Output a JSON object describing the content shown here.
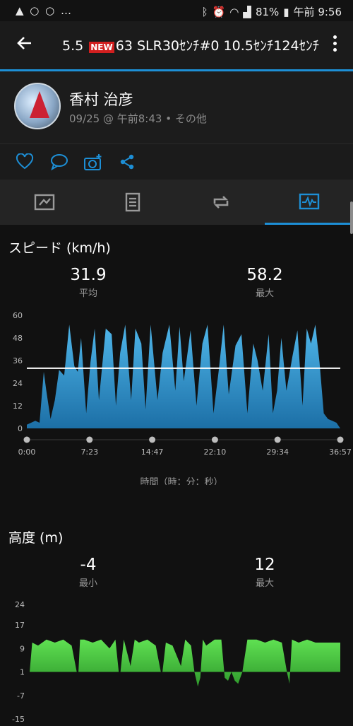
{
  "status_bar": {
    "left_text": "▲ ○ ○ …",
    "battery": "81%",
    "time": "午前 9:56",
    "icons": [
      "image-icon",
      "sync-icon",
      "sync-icon",
      "more-icon",
      "bluetooth-icon",
      "alarm-icon",
      "volte-icon",
      "wifi-icon",
      "signal-icon",
      "battery-icon"
    ]
  },
  "app_bar": {
    "title_prefix": "5.5",
    "badge": "NEW",
    "title_suffix": "63  SLR30ｾﾝﾁ#0  10.5ｾﾝﾁ124ｾﾝﾁ"
  },
  "profile": {
    "name": "香村 治彦",
    "meta": "09/25 @ 午前8:43 • その他"
  },
  "actions": [
    "heart-icon",
    "comment-icon",
    "camera-add-icon",
    "share-icon"
  ],
  "tabs": [
    {
      "name": "tab-map",
      "icon": "map-icon"
    },
    {
      "name": "tab-details",
      "icon": "details-icon"
    },
    {
      "name": "tab-laps",
      "icon": "laps-icon"
    },
    {
      "name": "tab-charts",
      "icon": "chart-icon",
      "active": true
    }
  ],
  "colors": {
    "accent": "#1d8fd6",
    "speed_fill": "#2f9fd9",
    "elevation_fill": "#4fcf46"
  },
  "speed": {
    "title": "スピード (km/h)",
    "avg_value": "31.9",
    "avg_label": "平均",
    "max_value": "58.2",
    "max_label": "最大",
    "x_axis_title": "時間（時：分：秒）"
  },
  "elevation": {
    "title": "高度 (m)",
    "min_value": "-4",
    "min_label": "最小",
    "max_value": "12",
    "max_label": "最大"
  },
  "chart_data": [
    {
      "type": "area",
      "y_unit": "km/h",
      "ylim": [
        0,
        60
      ],
      "yticks": [
        "0",
        "12",
        "24",
        "36",
        "48",
        "60"
      ],
      "xticks": [
        "0:00",
        "7:23",
        "14:47",
        "22:10",
        "29:34",
        "36:57"
      ],
      "x_minutes": [
        0,
        0.5,
        1,
        1.5,
        2,
        2.3,
        2.8,
        3.3,
        3.8,
        4.4,
        5,
        5.6,
        6,
        6.4,
        7,
        7.5,
        8,
        8.5,
        9.3,
        10,
        10.5,
        11,
        11.6,
        12.3,
        12.8,
        13.5,
        14,
        14.6,
        15.4,
        16,
        16.8,
        17.5,
        18,
        18.5,
        19.3,
        20,
        20.7,
        21.3,
        22,
        22.6,
        23.2,
        23.8,
        24.6,
        25.3,
        26,
        26.7,
        27.2,
        27.8,
        28.5,
        29,
        29.5,
        30,
        30.6,
        31.3,
        31.9,
        32.5,
        33,
        33.5,
        34,
        34.5,
        35,
        35.5,
        36,
        36.5,
        36.95
      ],
      "values": [
        2,
        3,
        4,
        3,
        30,
        20,
        5,
        15,
        31,
        28,
        55,
        33,
        30,
        48,
        8,
        35,
        53,
        15,
        53,
        50,
        12,
        40,
        55,
        15,
        53,
        45,
        10,
        55,
        15,
        40,
        55,
        20,
        54,
        25,
        52,
        12,
        45,
        55,
        8,
        30,
        55,
        18,
        44,
        50,
        8,
        45,
        36,
        20,
        50,
        8,
        20,
        48,
        20,
        38,
        52,
        12,
        53,
        45,
        55,
        35,
        8,
        5,
        4,
        3,
        0
      ],
      "mean_line": 31.9
    },
    {
      "type": "area",
      "y_unit": "m",
      "ylim": [
        -15,
        24
      ],
      "yticks": [
        "-15",
        "-7",
        "1",
        "9",
        "17",
        "24"
      ],
      "x_minutes": [
        0,
        0.3,
        1,
        2,
        3,
        4,
        5,
        5.6,
        5.8,
        6,
        6.5,
        7.5,
        8.5,
        9.5,
        10.2,
        10.6,
        10.8,
        11.2,
        12,
        12.5,
        13,
        14,
        15,
        15.6,
        15.8,
        16.2,
        17,
        18,
        18.5,
        19.2,
        19.6,
        20,
        20.3,
        20.6,
        21,
        21.5,
        22,
        22.8,
        23.2,
        23.6,
        24,
        24.4,
        24.8,
        25.3,
        25.9,
        26.2,
        26.6,
        27,
        28,
        29,
        30,
        30.6,
        30.9,
        31.2,
        32,
        33,
        34,
        35,
        36,
        36.95
      ],
      "values": [
        1,
        11,
        10,
        12,
        11,
        12,
        10,
        1,
        1,
        12,
        12,
        11,
        12,
        9,
        12,
        1,
        1,
        12,
        3,
        12,
        11,
        12,
        10,
        1,
        1,
        11,
        10,
        3,
        12,
        10,
        1,
        -4,
        -1,
        12,
        10,
        11,
        12,
        12,
        -1,
        -2,
        1,
        -2,
        -3,
        1,
        12,
        12,
        12,
        12,
        11,
        12,
        11,
        1,
        -3,
        12,
        11,
        12,
        11,
        11,
        11,
        11
      ]
    }
  ]
}
